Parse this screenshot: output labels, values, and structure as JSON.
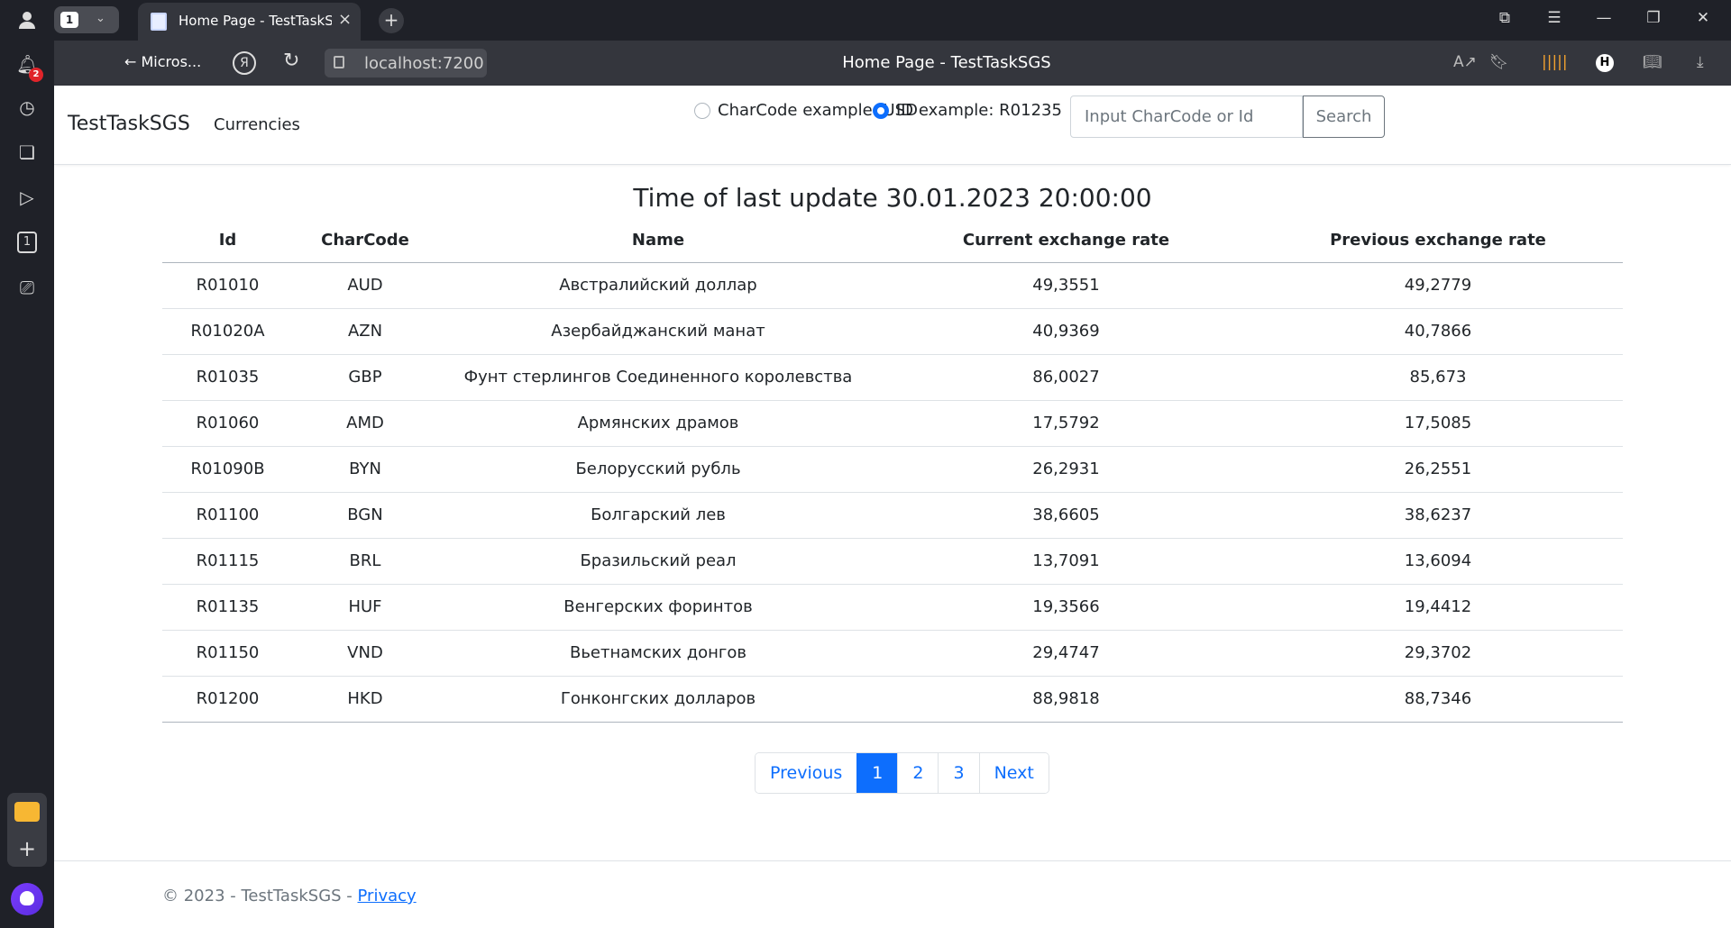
{
  "browser": {
    "tab_count": "1",
    "tab_title": "Home Page - TestTaskSGS",
    "back_label": "Micros...",
    "url": "localhost:7200",
    "page_title": "Home Page - TestTaskSGS",
    "notification_count": "2",
    "sidebar_tab_count": "1"
  },
  "navbar": {
    "brand": "TestTaskSGS",
    "currencies_link": "Currencies",
    "radio_charcode_label": "CharCode example: USD",
    "radio_id_label": "ID example: R01235",
    "search_placeholder": "Input CharCode or Id",
    "search_button": "Search"
  },
  "main": {
    "update_title": "Time of last update 30.01.2023 20:00:00",
    "columns": [
      "Id",
      "CharCode",
      "Name",
      "Current exchange rate",
      "Previous exchange rate"
    ],
    "rows": [
      [
        "R01010",
        "AUD",
        "Австралийский доллар",
        "49,3551",
        "49,2779"
      ],
      [
        "R01020A",
        "AZN",
        "Азербайджанский манат",
        "40,9369",
        "40,7866"
      ],
      [
        "R01035",
        "GBP",
        "Фунт стерлингов Соединенного королевства",
        "86,0027",
        "85,673"
      ],
      [
        "R01060",
        "AMD",
        "Армянских драмов",
        "17,5792",
        "17,5085"
      ],
      [
        "R01090B",
        "BYN",
        "Белорусский рубль",
        "26,2931",
        "26,2551"
      ],
      [
        "R01100",
        "BGN",
        "Болгарский лев",
        "38,6605",
        "38,6237"
      ],
      [
        "R01115",
        "BRL",
        "Бразильский реал",
        "13,7091",
        "13,6094"
      ],
      [
        "R01135",
        "HUF",
        "Венгерских форинтов",
        "19,3566",
        "19,4412"
      ],
      [
        "R01150",
        "VND",
        "Вьетнамских донгов",
        "29,4747",
        "29,3702"
      ],
      [
        "R01200",
        "HKD",
        "Гонконгских долларов",
        "88,9818",
        "88,7346"
      ]
    ],
    "pagination": {
      "previous": "Previous",
      "pages": [
        "1",
        "2",
        "3"
      ],
      "next": "Next"
    }
  },
  "footer": {
    "copyright": "© 2023 - TestTaskSGS - ",
    "privacy_link": "Privacy"
  }
}
